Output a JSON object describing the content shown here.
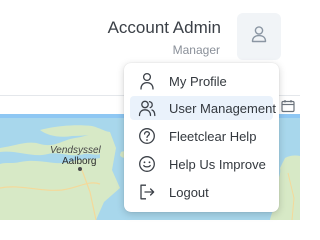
{
  "header": {
    "user_name": "Account Admin",
    "user_role": "Manager",
    "avatar_icon": "user-icon"
  },
  "toolbar": {
    "calendar_icon": "calendar-icon",
    "progress_color": "#8ec7f3"
  },
  "map": {
    "labels": {
      "region": "Vendsyssel",
      "city": "Aalborg"
    },
    "water_color": "#a8d7ec",
    "land_color": "#d7e9c6"
  },
  "user_menu": {
    "items": [
      {
        "label": "My Profile",
        "icon": "user-icon",
        "active": false
      },
      {
        "label": "User Management",
        "icon": "users-icon",
        "active": true
      },
      {
        "label": "Fleetclear Help",
        "icon": "help-circle-icon",
        "active": false
      },
      {
        "label": "Help Us Improve",
        "icon": "smile-icon",
        "active": false
      },
      {
        "label": "Logout",
        "icon": "logout-icon",
        "active": false
      }
    ],
    "active_bg": "#eaf2fb"
  }
}
